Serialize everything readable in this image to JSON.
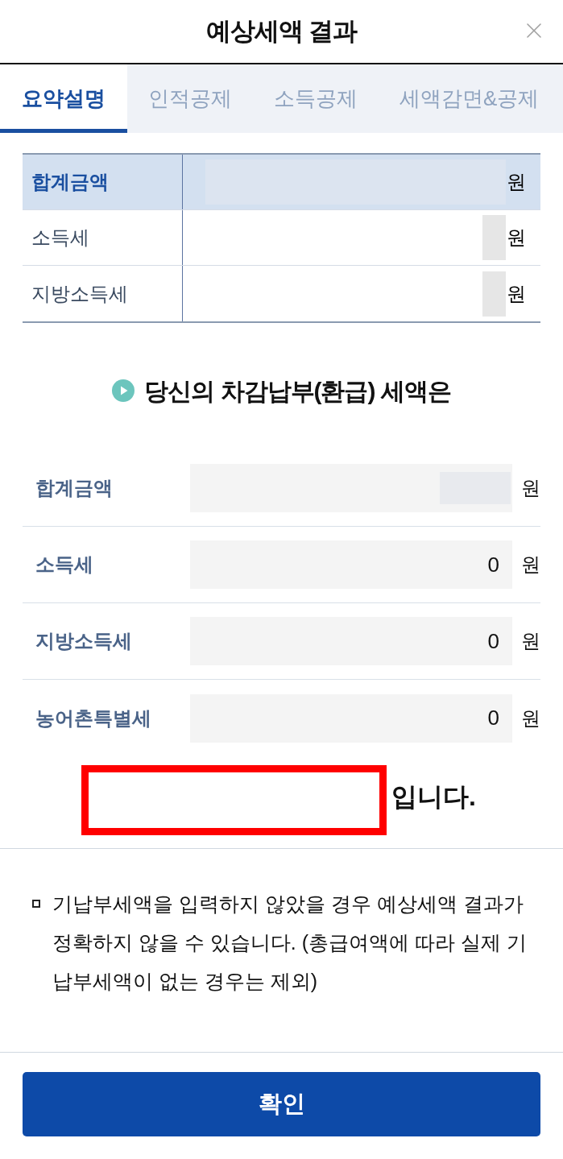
{
  "header": {
    "title": "예상세액 결과"
  },
  "tabs": [
    {
      "label": "요약설명",
      "selected": true
    },
    {
      "label": "인적공제",
      "selected": false
    },
    {
      "label": "소득공제",
      "selected": false
    },
    {
      "label": "세액감면&공제",
      "selected": false
    }
  ],
  "summary_table": {
    "rows": [
      {
        "label": "합계금액",
        "highlight": true,
        "masked": true,
        "unit": "원"
      },
      {
        "label": "소득세",
        "highlight": false,
        "masked": true,
        "unit": "원"
      },
      {
        "label": "지방소득세",
        "highlight": false,
        "masked": true,
        "unit": "원"
      }
    ]
  },
  "result_section": {
    "heading": "당신의 차감납부(환급) 세액은",
    "rows": [
      {
        "label": "합계금액",
        "masked": true,
        "unit": "원"
      },
      {
        "label": "소득세",
        "masked": false,
        "value": "0",
        "unit": "원"
      },
      {
        "label": "지방소득세",
        "masked": false,
        "value": "0",
        "unit": "원"
      },
      {
        "label": "농어촌특별세",
        "masked": false,
        "value": "0",
        "unit": "원"
      }
    ],
    "conclusion": {
      "masked": true,
      "suffix": "입니다."
    }
  },
  "note": {
    "text": "기납부세액을 입력하지 않았을 경우 예상세액 결과가 정확하지 않을 수 있습니다. (총급여액에 따라 실제 기납부세액이 없는 경우는 제외)"
  },
  "confirm_button": {
    "label": "확인"
  }
}
